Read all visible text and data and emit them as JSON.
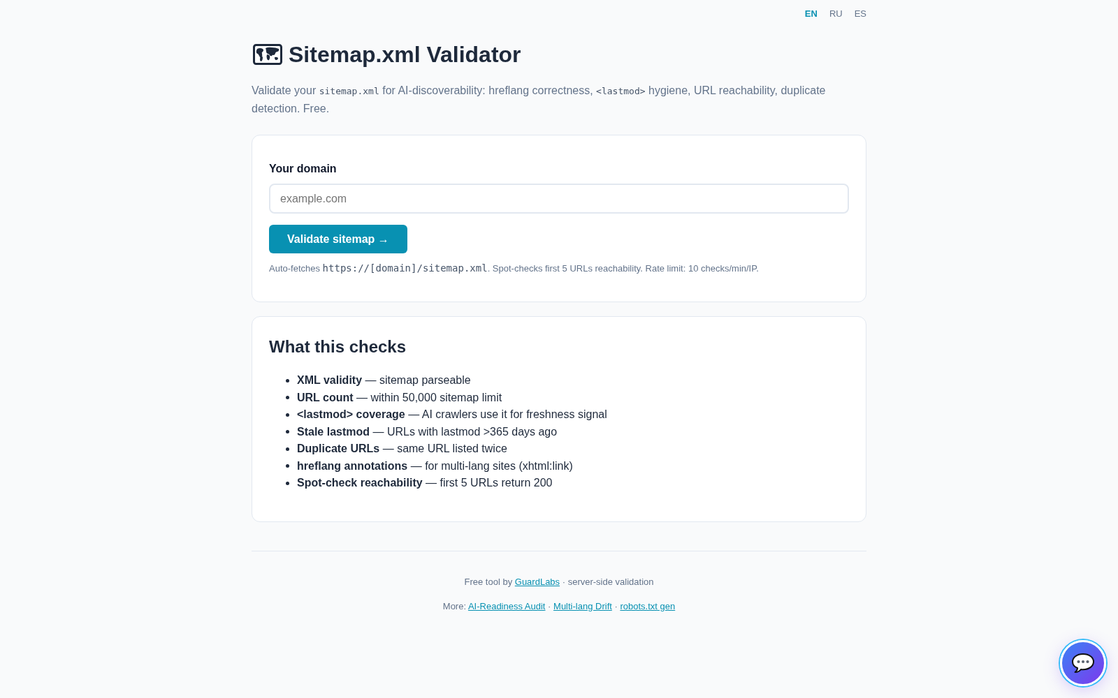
{
  "language_switcher": [
    {
      "label": "EN",
      "selected": true
    },
    {
      "label": "RU",
      "selected": false
    },
    {
      "label": "ES",
      "selected": false
    }
  ],
  "header": {
    "title": "Sitemap.xml Validator",
    "description": [
      {
        "kind": "text",
        "text": "Validate your "
      },
      {
        "kind": "code",
        "text": "sitemap.xml"
      },
      {
        "kind": "text",
        "text": " for AI-discoverability: hreflang correctness, "
      },
      {
        "kind": "code",
        "text": "<lastmod>"
      },
      {
        "kind": "text",
        "text": " hygiene, URL reachability, duplicate detection. Free."
      }
    ]
  },
  "domain_form": {
    "label": "Your domain",
    "input": {
      "placeholder": "example.com"
    },
    "submit_button": "Validate sitemap →",
    "hint": [
      {
        "kind": "text",
        "text": "Auto-fetches "
      },
      {
        "kind": "code",
        "text": "https://[domain]/sitemap.xml"
      },
      {
        "kind": "text",
        "text": ". Spot-checks first 5 URLs reachability. Rate limit: 10 checks/min/IP."
      }
    ]
  },
  "checks_card": {
    "title": "What this checks",
    "items": [
      "**XML validity** — sitemap parseable",
      "**URL count** — within 50,000 sitemap limit",
      "**<lastmod> coverage** — AI crawlers use it for freshness signal",
      "**Stale lastmod** — URLs with lastmod >365 days ago",
      "**Duplicate URLs** — same URL listed twice",
      "**hreflang annotations** — for multi-lang sites (xhtml:link)",
      "**Spot-check reachability** — first 5 URLs return 200"
    ]
  },
  "footer": {
    "lines": [
      {
        "segments": [
          {
            "kind": "text",
            "text": "Free tool by "
          },
          {
            "kind": "link",
            "text": "GuardLabs"
          },
          {
            "kind": "text",
            "text": " · server-side validation"
          }
        ]
      },
      {
        "segments": [
          {
            "kind": "text",
            "text": "More: "
          },
          {
            "kind": "link",
            "text": "AI-Readiness Audit"
          },
          {
            "kind": "text",
            "text": " · "
          },
          {
            "kind": "link",
            "text": "Multi-lang Drift"
          },
          {
            "kind": "text",
            "text": " · "
          },
          {
            "kind": "link",
            "text": "robots.txt gen"
          }
        ]
      }
    ]
  }
}
